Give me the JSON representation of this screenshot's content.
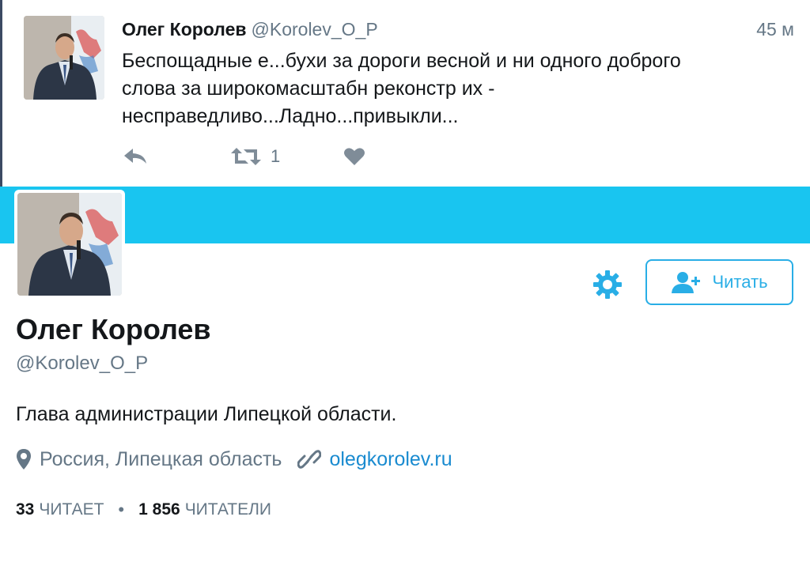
{
  "tweet": {
    "name": "Олег Королев",
    "handle": "@Korolev_O_P",
    "time": "45 м",
    "text": "Беспощадные е...бухи за дороги весной и ни одного доброго\nслова за широкомасштабн реконстр их -\nнесправедливо...Ладно...привыкли...",
    "retweet_count": "1",
    "icons": {
      "reply": "reply-icon",
      "retweet": "retweet-icon",
      "like": "heart-icon"
    }
  },
  "profile": {
    "name": "Олег Королев",
    "handle": "@Korolev_O_P",
    "bio": "Глава администрации Липецкой области.",
    "location": "Россия, Липецкая область",
    "url": "olegkorolev.ru",
    "follow_label": "Читать",
    "stats": {
      "following_count": "33",
      "following_label": "ЧИТАЕТ",
      "followers_count": "1 856",
      "followers_label": "ЧИТАТЕЛИ"
    }
  },
  "colors": {
    "banner": "#19c5f0",
    "accent": "#29aee6",
    "link": "#1a8bd0",
    "muted": "#657786",
    "text": "#14171a"
  }
}
